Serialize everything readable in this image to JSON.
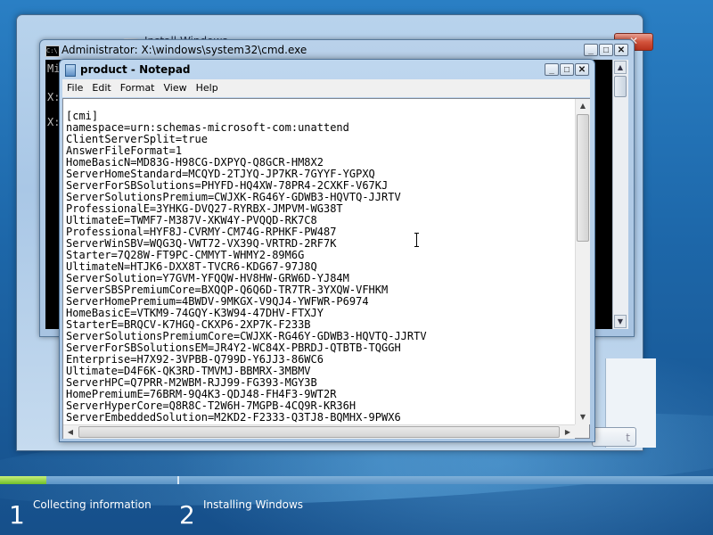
{
  "setup_window": {
    "title": "Install Windows",
    "next_label": "t"
  },
  "cmd_window": {
    "title": "Administrator: X:\\windows\\system32\\cmd.exe",
    "icon_text": "C:\\",
    "visible_lines": [
      "Mi",
      "",
      "X:",
      "",
      "X:"
    ],
    "minimize_label": "_",
    "maximize_label": "□",
    "close_label": "✕"
  },
  "notepad": {
    "title": "product - Notepad",
    "minimize_label": "_",
    "maximize_label": "□",
    "close_label": "✕",
    "menu": [
      "File",
      "Edit",
      "Format",
      "View",
      "Help"
    ],
    "lines": [
      "[cmi]",
      "namespace=urn:schemas-microsoft-com:unattend",
      "ClientServerSplit=true",
      "AnswerFileFormat=1",
      "HomeBasicN=MD83G-H98CG-DXPYQ-Q8GCR-HM8X2",
      "ServerHomeStandard=MCQYD-2TJYQ-JP7KR-7GYYF-YGPXQ",
      "ServerForSBSolutions=PHYFD-HQ4XW-78PR4-2CXKF-V67KJ",
      "ServerSolutionsPremium=CWJXK-RG46Y-GDWB3-HQVTQ-JJRTV",
      "ProfessionalE=3YHKG-DVQ27-RYRBX-JMPVM-WG38T",
      "UltimateE=TWMF7-M387V-XKW4Y-PVQQD-RK7C8",
      "Professional=HYF8J-CVRMY-CM74G-RPHKF-PW487",
      "ServerWinSBV=WQG3Q-VWT72-VX39Q-VRTRD-2RF7K",
      "Starter=7Q28W-FT9PC-CMMYT-WHMY2-89M6G",
      "UltimateN=HTJK6-DXX8T-TVCR6-KDG67-97J8Q",
      "ServerSolution=Y7GVM-YFQQW-HV8HW-GRW6D-YJ84M",
      "ServerSBSPremiumCore=BXQQP-Q6Q6D-TR7TR-3YXQW-VFHKM",
      "ServerHomePremium=4BWDV-9MKGX-V9QJ4-YWFWR-P6974",
      "HomeBasicE=VTKM9-74GQY-K3W94-47DHV-FTXJY",
      "StarterE=BRQCV-K7HGQ-CKXP6-2XP7K-F233B",
      "ServerSolutionsPremiumCore=CWJXK-RG46Y-GDWB3-HQVTQ-JJRTV",
      "ServerForSBSolutionsEM=JR4Y2-WC84X-PBRDJ-QTBTB-TQGGH",
      "Enterprise=H7X92-3VPBB-Q799D-Y6JJ3-86WC6",
      "Ultimate=D4F6K-QK3RD-TMVMJ-BBMRX-3MBMV",
      "ServerHPC=Q7PRR-M2WBM-RJJ99-FG393-MGY3B",
      "HomePremiumE=76BRM-9Q4K3-QDJ48-FH4F3-9WT2R",
      "ServerHyperCore=Q8R8C-T2W6H-7MGPB-4CQ9R-KR36H",
      "ServerEmbeddedSolution=M2KD2-F2333-Q3TJ8-BQMHX-9PWX6"
    ]
  },
  "scroll_arrows": {
    "up": "▲",
    "down": "▼",
    "left": "◀",
    "right": "▶"
  },
  "setup_progress": {
    "progress_fraction": 0.065,
    "steps": [
      {
        "number": "1",
        "label": "Collecting information"
      },
      {
        "number": "2",
        "label": "Installing Windows"
      }
    ]
  },
  "colors": {
    "desktop": "#1e6fae",
    "progress_fill": "#6fbf2a",
    "cmd_background": "#000000",
    "cmd_text": "#c0c0c0"
  }
}
